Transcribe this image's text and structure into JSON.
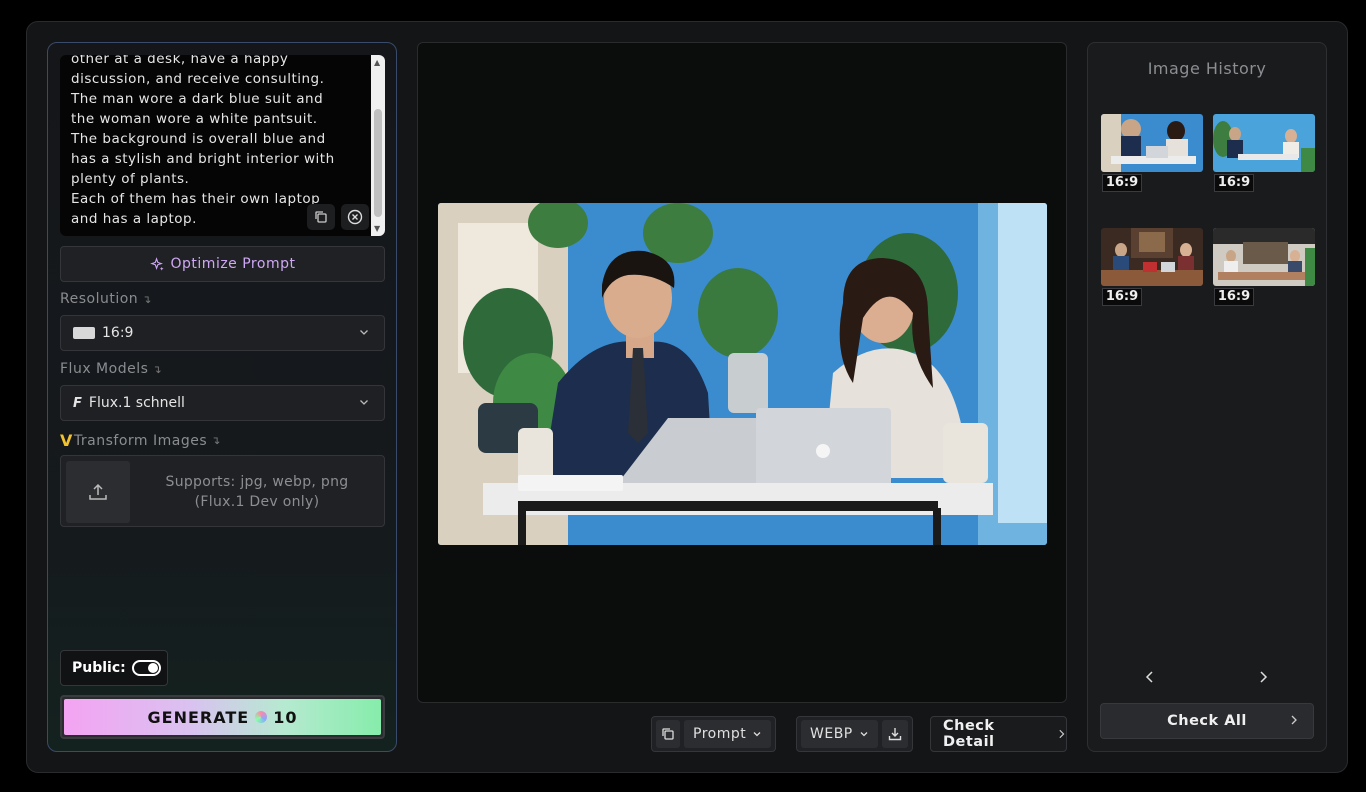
{
  "prompt": {
    "text": "other at a desk, have a happy\ndiscussion, and receive consulting.\nThe man wore a dark blue suit and\nthe woman wore a white pantsuit.\nThe background is overall blue and\nhas a stylish and bright interior with\nplenty of plants.\nEach of them has their own laptop\nand has a laptop.",
    "copy_icon": "copy-icon",
    "clear_icon": "clear-icon"
  },
  "optimize_label": "Optimize Prompt",
  "resolution": {
    "label": "Resolution",
    "value": "16:9"
  },
  "flux_models": {
    "label": "Flux Models",
    "value": "Flux.1 schnell"
  },
  "transform": {
    "label": "Transform Images",
    "badge": "V",
    "support_line1": "Supports: jpg, webp, png",
    "support_line2": "(Flux.1 Dev only)"
  },
  "public": {
    "label": "Public:",
    "on": true
  },
  "generate": {
    "label": "GENERATE",
    "credits": "10"
  },
  "toolbar": {
    "prompt_label": "Prompt",
    "format_label": "WEBP",
    "check_detail_label": "Check Detail"
  },
  "history": {
    "title": "Image History",
    "items": [
      {
        "ratio": "16:9"
      },
      {
        "ratio": "16:9"
      },
      {
        "ratio": "16:9"
      },
      {
        "ratio": "16:9"
      }
    ],
    "check_all_label": "Check All"
  },
  "colors": {
    "accent_purple": "#cfa8f5",
    "badge_gold": "#f2c12e",
    "gen_start": "#f4a3f2",
    "gen_end": "#86ecab"
  }
}
